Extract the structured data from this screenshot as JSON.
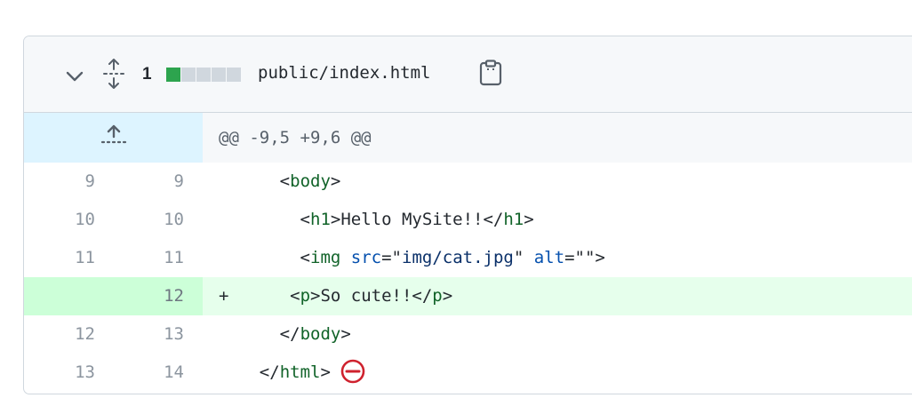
{
  "file": {
    "changes_count": "1",
    "diffstat": [
      "added",
      "neutral",
      "neutral",
      "neutral",
      "neutral"
    ],
    "filename": "public/index.html"
  },
  "colors": {
    "added_block": "#2da44e",
    "neutral_block": "#d0d7de",
    "no_eol_icon": "#cf222e"
  },
  "hunk_header": "@@ -9,5 +9,6 @@",
  "lines": [
    {
      "old": "9",
      "new": "9",
      "marker": "",
      "indent": "    ",
      "tokens": [
        [
          "p",
          "<"
        ],
        [
          "t",
          "body"
        ],
        [
          "p",
          ">"
        ]
      ]
    },
    {
      "old": "10",
      "new": "10",
      "marker": "",
      "indent": "      ",
      "tokens": [
        [
          "p",
          "<"
        ],
        [
          "t",
          "h1"
        ],
        [
          "p",
          ">Hello MySite!!</"
        ],
        [
          "t",
          "h1"
        ],
        [
          "p",
          ">"
        ]
      ]
    },
    {
      "old": "11",
      "new": "11",
      "marker": "",
      "indent": "      ",
      "tokens": [
        [
          "p",
          "<"
        ],
        [
          "t",
          "img"
        ],
        [
          "p",
          " "
        ],
        [
          "a",
          "src"
        ],
        [
          "p",
          "=\""
        ],
        [
          "s",
          "img/cat.jpg"
        ],
        [
          "p",
          "\" "
        ],
        [
          "a",
          "alt"
        ],
        [
          "p",
          "=\"\">"
        ]
      ]
    },
    {
      "old": "",
      "new": "12",
      "marker": "+",
      "indent": "     ",
      "tokens": [
        [
          "p",
          "<"
        ],
        [
          "t",
          "p"
        ],
        [
          "p",
          ">So cute!!</"
        ],
        [
          "t",
          "p"
        ],
        [
          "p",
          ">"
        ]
      ]
    },
    {
      "old": "12",
      "new": "13",
      "marker": "",
      "indent": "    ",
      "tokens": [
        [
          "p",
          "</"
        ],
        [
          "t",
          "body"
        ],
        [
          "p",
          ">"
        ]
      ]
    },
    {
      "old": "13",
      "new": "14",
      "marker": "",
      "indent": "  ",
      "tokens": [
        [
          "p",
          "</"
        ],
        [
          "t",
          "html"
        ],
        [
          "p",
          ">"
        ]
      ],
      "no_newline_icon": "no-entry-icon"
    }
  ],
  "icons": {
    "collapse": "chevron-down-icon",
    "expand_all": "unfold-icon",
    "copy": "copy-path-icon",
    "expand_up": "expand-up-icon"
  }
}
